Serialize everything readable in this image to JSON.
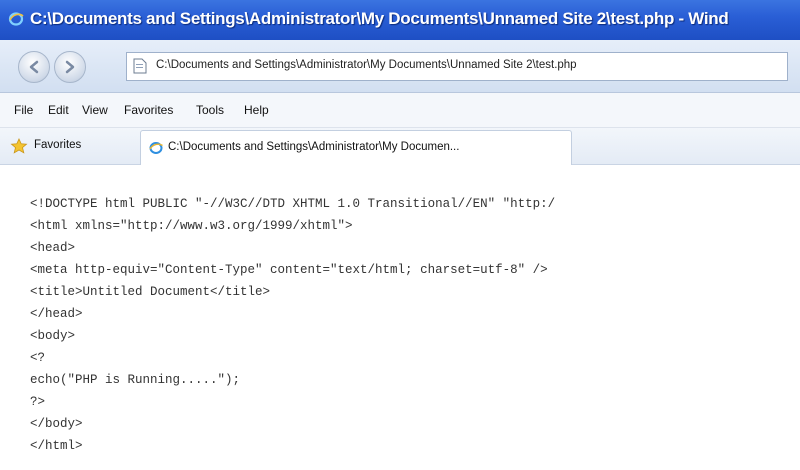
{
  "window": {
    "title": "C:\\Documents and Settings\\Administrator\\My Documents\\Unnamed Site 2\\test.php - Wind"
  },
  "address_bar": {
    "url": "C:\\Documents and Settings\\Administrator\\My Documents\\Unnamed Site 2\\test.php"
  },
  "menu": {
    "items": [
      "File",
      "Edit",
      "View",
      "Favorites",
      "Tools",
      "Help"
    ]
  },
  "favorites_bar": {
    "label": "Favorites",
    "tab_title": "C:\\Documents and Settings\\Administrator\\My Documen..."
  },
  "icons": {
    "title": "ie-logo-icon",
    "back": "back-arrow-icon",
    "forward": "forward-arrow-icon",
    "page": "page-icon",
    "favorites": "star-icon",
    "tab": "ie-tab-icon"
  },
  "content": {
    "lines": [
      "<!DOCTYPE html PUBLIC \"-//W3C//DTD XHTML 1.0 Transitional//EN\" \"http:/",
      "<html xmlns=\"http://www.w3.org/1999/xhtml\">",
      "<head>",
      "<meta http-equiv=\"Content-Type\" content=\"text/html; charset=utf-8\" />",
      "<title>Untitled Document</title>",
      "</head>",
      "<body>",
      "<?",
      "echo(\"PHP is Running.....\");",
      "?>",
      "</body>",
      "</html>"
    ]
  }
}
